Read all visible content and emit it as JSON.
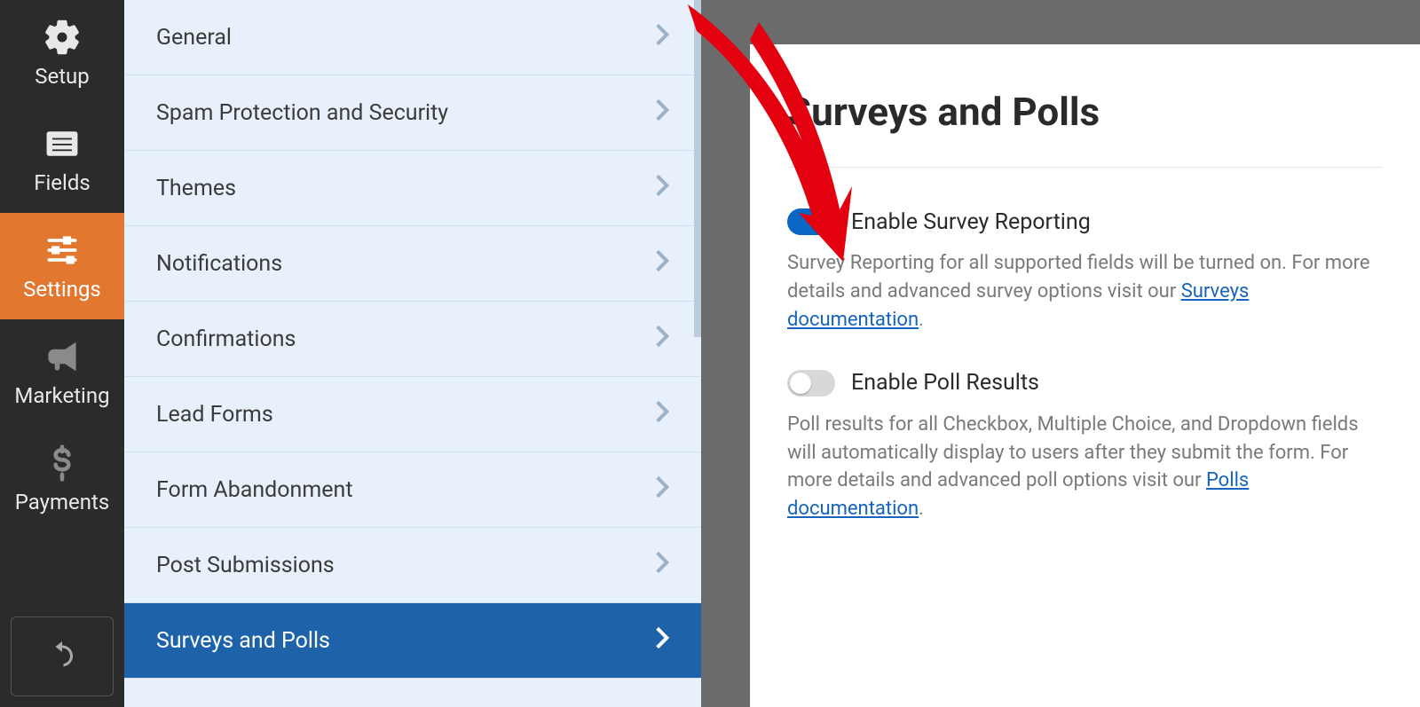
{
  "sidebar": {
    "items": [
      {
        "label": "Setup"
      },
      {
        "label": "Fields"
      },
      {
        "label": "Settings"
      },
      {
        "label": "Marketing"
      },
      {
        "label": "Payments"
      }
    ]
  },
  "settings_list": {
    "items": [
      {
        "label": "General"
      },
      {
        "label": "Spam Protection and Security"
      },
      {
        "label": "Themes"
      },
      {
        "label": "Notifications"
      },
      {
        "label": "Confirmations"
      },
      {
        "label": "Lead Forms"
      },
      {
        "label": "Form Abandonment"
      },
      {
        "label": "Post Submissions"
      },
      {
        "label": "Surveys and Polls"
      }
    ]
  },
  "panel": {
    "title": "Surveys and Polls",
    "survey": {
      "toggle_on": true,
      "label": "Enable Survey Reporting",
      "desc_before": "Survey Reporting for all supported fields will be turned on. For more details and advanced survey options visit our ",
      "link_text": "Surveys documentation",
      "desc_after": "."
    },
    "poll": {
      "toggle_on": false,
      "label": "Enable Poll Results",
      "desc_before": "Poll results for all Checkbox, Multiple Choice, and Dropdown fields will automatically display to users after they submit the form. For more details and advanced poll options visit our ",
      "link_text": "Polls documentation",
      "desc_after": "."
    }
  }
}
